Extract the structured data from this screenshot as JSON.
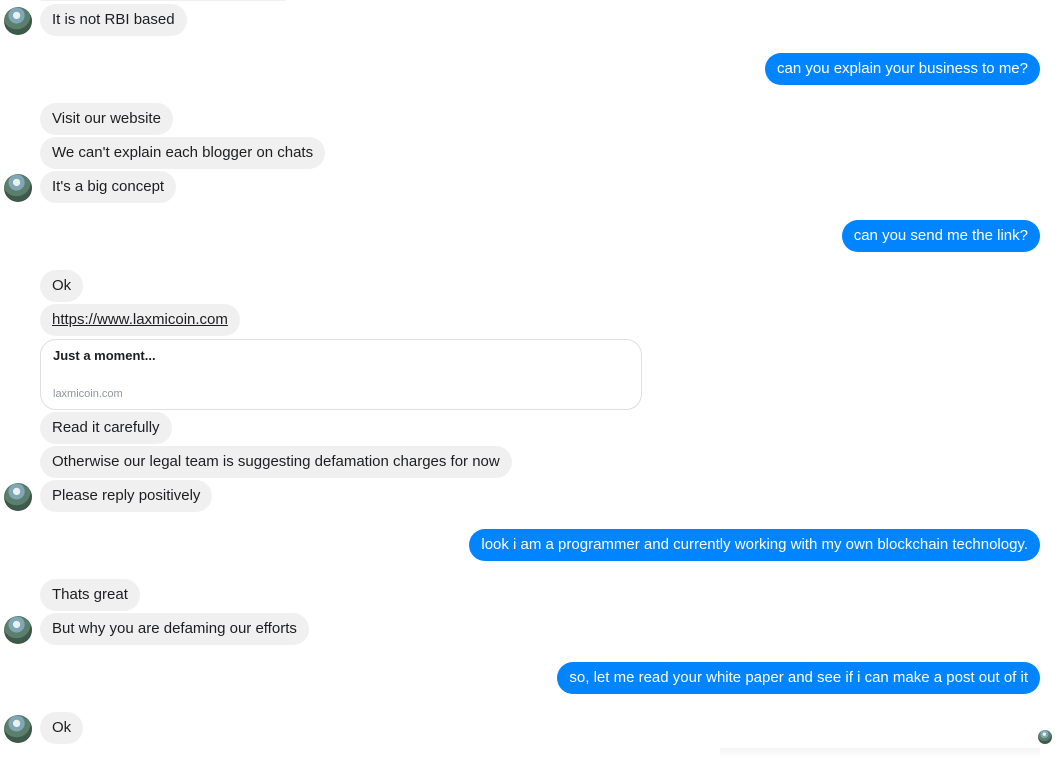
{
  "messages": [
    {
      "side": "in",
      "text": "It is not RBI based"
    },
    {
      "side": "out",
      "text": "can you explain your business to me?"
    },
    {
      "side": "in",
      "text": "Visit our website"
    },
    {
      "side": "in",
      "text": "We can't explain each blogger on chats"
    },
    {
      "side": "in",
      "text": "It's a big concept"
    },
    {
      "side": "out",
      "text": "can you send me the link?"
    },
    {
      "side": "in",
      "text": "Ok"
    },
    {
      "side": "in",
      "text": "https://www.laxmicoin.com",
      "link": true
    },
    {
      "side": "in",
      "text": "Read it carefully"
    },
    {
      "side": "in",
      "text": "Otherwise our legal team is suggesting defamation charges for now"
    },
    {
      "side": "in",
      "text": "Please reply positively"
    },
    {
      "side": "out",
      "text": "look i am a programmer and currently working with my own blockchain technology."
    },
    {
      "side": "in",
      "text": "Thats great"
    },
    {
      "side": "in",
      "text": "But why you are defaming our efforts"
    },
    {
      "side": "out",
      "text": "so, let me read your white paper and see if i can make a post out of it"
    },
    {
      "side": "in",
      "text": "Ok"
    }
  ],
  "link_preview": {
    "title": "Just a moment...",
    "domain": "laxmicoin.com"
  },
  "colors": {
    "incoming_bubble": "#f1f0f0",
    "outgoing_bubble": "#0084ff",
    "incoming_text": "#1c1e21",
    "outgoing_text": "#ffffff"
  }
}
